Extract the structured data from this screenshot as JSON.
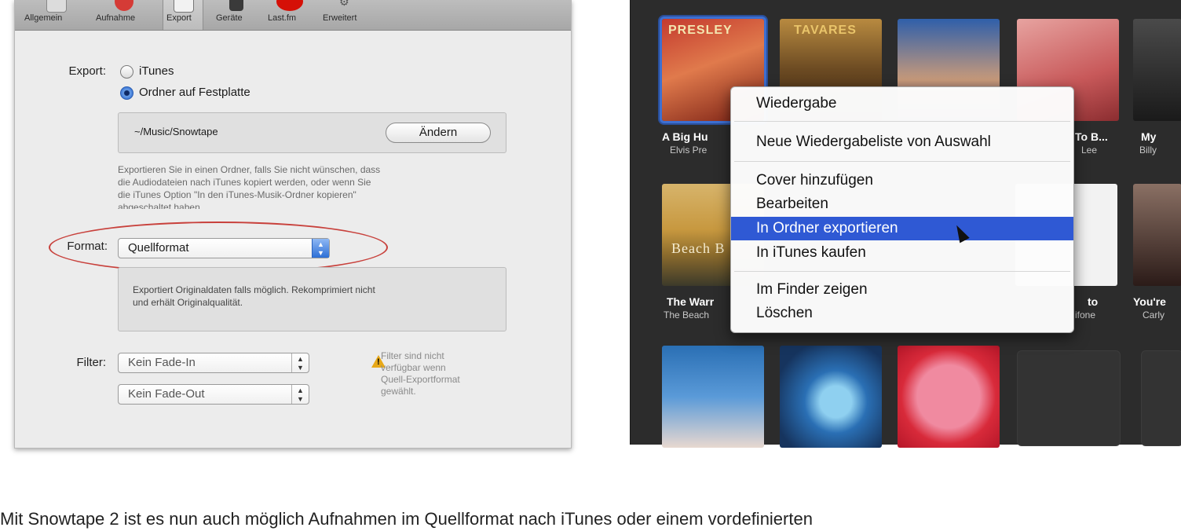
{
  "toolbar": {
    "items": [
      "Allgemein",
      "Aufnahme",
      "Export",
      "Geräte",
      "Last.fm",
      "Erweitert"
    ],
    "selected": "Export"
  },
  "export": {
    "label": "Export:",
    "option_itunes": "iTunes",
    "option_folder": "Ordner auf Festplatte",
    "selected": "Ordner auf Festplatte",
    "path": "~/Music/Snowtape",
    "change_button": "Ändern",
    "help_line1": "Exportieren Sie in einen Ordner, falls Sie nicht wünschen, dass",
    "help_line2": "die Audiodateien nach iTunes kopiert werden, oder wenn Sie",
    "help_line3": "die iTunes Option \"In den iTunes-Musik-Ordner kopieren\"",
    "help_line4": "abgeschaltet haben."
  },
  "format": {
    "label": "Format:",
    "value": "Quellformat",
    "desc_line1": "Exportiert Originaldaten falls möglich. Rekomprimiert nicht",
    "desc_line2": "und erhält Originalqualität."
  },
  "filter": {
    "label": "Filter:",
    "fade_in": "Kein Fade-In",
    "fade_out": "Kein Fade-Out",
    "warning_line1": "Filter sind nicht",
    "warning_line2": "verfügbar wenn",
    "warning_line3": "Quell-Exportformat",
    "warning_line4": "gewählt."
  },
  "albums": [
    {
      "title": "A Big Hu",
      "artist": "Elvis Pre",
      "cover_text": "PRESLEY"
    },
    {
      "title": "",
      "artist": "",
      "cover_text": "TAVARES"
    },
    {
      "title": "",
      "artist": "",
      "cover_text": ""
    },
    {
      "title": "To B...",
      "artist": "Lee",
      "cover_text": ""
    },
    {
      "title": "My",
      "artist": "Billy",
      "cover_text": ""
    },
    {
      "title": "The Warr",
      "artist": "The Beach",
      "cover_text": "Beach B"
    },
    {
      "title": "to",
      "artist": "ifone",
      "cover_text": ""
    },
    {
      "title": "You're",
      "artist": "Carly",
      "cover_text": ""
    }
  ],
  "context_menu": {
    "items": [
      "Wiedergabe",
      "Neue Wiedergabeliste von Auswahl",
      "Cover hinzufügen",
      "Bearbeiten",
      "In Ordner exportieren",
      "In iTunes kaufen",
      "Im Finder zeigen",
      "Löschen"
    ],
    "highlighted": "In Ordner exportieren"
  },
  "caption": "Mit Snowtape 2 ist es nun auch möglich Aufnahmen im Quellformat nach iTunes oder einem vordefinierten",
  "colors": {
    "highlight": "#2f59d4",
    "annotation_ellipse": "#c8413c",
    "warning": "#e7a817",
    "browser_bg": "#2c2c2c"
  }
}
